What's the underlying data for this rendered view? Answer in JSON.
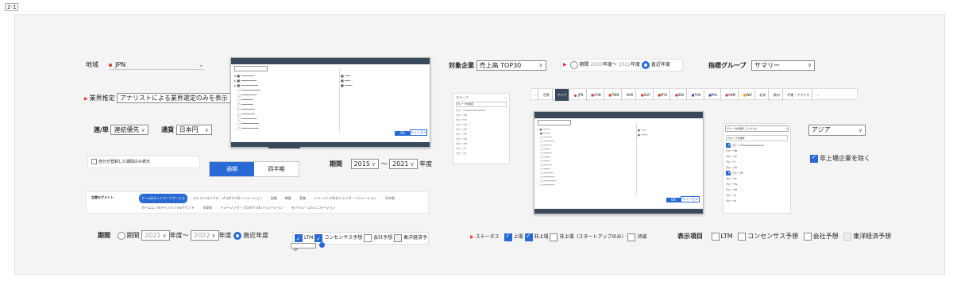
{
  "tag": "2-1",
  "region": {
    "label": "地域",
    "value": "JPN"
  },
  "industry": {
    "label": "業界推定",
    "value": "アナリストによる業界選定のみを表示"
  },
  "consolidation": {
    "label": "連/単",
    "value": "連結優先"
  },
  "currency": {
    "label": "通貨",
    "value": "日本円"
  },
  "onlyMine": {
    "label": "自分が登録した期間のみ表示"
  },
  "periodToggle": {
    "left": "通期",
    "right": "四半期"
  },
  "periodRange": {
    "label": "期間",
    "from": "2015",
    "sep": "〜",
    "to": "2021",
    "unit": "年度"
  },
  "segment": {
    "label": "主要セグメント",
    "chips": [
      "ゲーム&ネットワークサービス",
      "エレクトロニクス・プロダクツ&ソリューション",
      "金融",
      "映画",
      "音楽",
      "イメージング&センシング・ソリューション",
      "その他",
      "ホームエンタテインメント&サウンド",
      "半導体",
      "イメージング・プロダクツ&ソリューション",
      "モバイル・コミュニケーション"
    ]
  },
  "period2": {
    "label": "期間",
    "opt1": "期間",
    "from": "2021",
    "mid": "年度〜",
    "to": "2022",
    "unit": "年度",
    "opt2": "直近年度"
  },
  "forecastChecks": {
    "items": [
      "LTM",
      "コンセンサス予想",
      "会社予想",
      "東洋経済予想"
    ]
  },
  "target": {
    "label": "対象企業",
    "value": "売上高 TOP30"
  },
  "period3": {
    "opt1": "期間",
    "from": "2020",
    "mid": "年度〜",
    "to": "2021",
    "unit": "年度",
    "opt2": "直近年度"
  },
  "indicator": {
    "label": "指標グループ",
    "value": "サマリー"
  },
  "countryTabs": [
    "世界",
    "アジア",
    "JPN",
    "CHN",
    "TWN",
    "KOR",
    "SGP",
    "MYS",
    "IDN",
    "THA",
    "PHL",
    "VNM",
    "IND",
    "北米",
    "欧州",
    "中東・アフリカ"
  ],
  "groupPanel": {
    "title": "グループ",
    "placeholder": "グループを検索",
    "items": [
      "グループAAAAAAAAAAAA",
      "グループB",
      "グループC",
      "グループD",
      "グループE",
      "グループF",
      "グループG",
      "グループH",
      "グループI",
      "グループJ"
    ]
  },
  "groupDropdown": {
    "placeholder": "グループを選択してください",
    "search": "グループを検索",
    "items": [
      "グループAAAAAAAAAAAAA",
      "グループB",
      "グループC",
      "グループ",
      "グループD",
      "グループE",
      "グループF",
      "グループG",
      "グループH",
      "グループI",
      "グループJ"
    ]
  },
  "regionSelect": {
    "value": "アジア"
  },
  "excludeUnlisted": {
    "label": "非上場企業を除く"
  },
  "status": {
    "label": "ステータス",
    "items": [
      "上場",
      "非上場",
      "非上場（スタートアップのみ）",
      "消滅"
    ]
  },
  "display": {
    "label": "表示項目",
    "items": [
      "LTM",
      "コンセンサス予想",
      "会社予想",
      "東洋経済予想"
    ]
  },
  "modal": {
    "ok": "OK",
    "cancel": "キャンセル"
  },
  "colors": {
    "accent": "#2a6ad4",
    "flagRed": "#d33",
    "headerDark": "#3a4a5c"
  }
}
